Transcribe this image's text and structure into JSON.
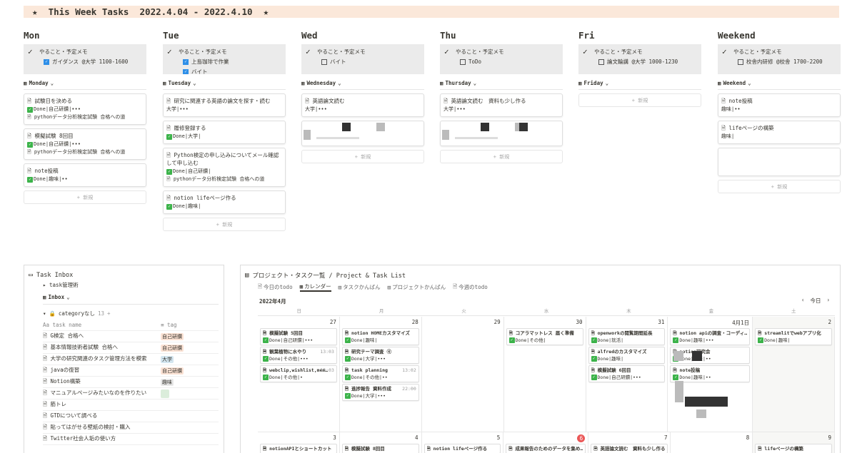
{
  "banner": "★  This Week Tasks  2022.4.04 - 2022.4.10  ★",
  "columns": [
    {
      "day": "Mon",
      "memo": "やること・予定メモ",
      "subs": [
        {
          "checked": true,
          "text": "ガイダンス @大学 1100-1600"
        }
      ],
      "group": "Monday",
      "cards": [
        {
          "name": "試験日を決める",
          "status": "Done|自己研鑽|•••",
          "rel": "pythonデータ分析検定試験 合格への道"
        },
        {
          "name": "模擬試験 8回目",
          "status": "Done|自己研鑽|•••",
          "rel": "pythonデータ分析検定試験 合格への道"
        },
        {
          "name": "note投稿",
          "status": "Done|趣味|••",
          "rel": ""
        }
      ]
    },
    {
      "day": "Tue",
      "memo": "やること・予定メモ",
      "subs": [
        {
          "checked": true,
          "text": "上島珈琲で作業"
        },
        {
          "checked": true,
          "text": "バイト"
        }
      ],
      "group": "Tuesday",
      "cards": [
        {
          "name": "研究に関連する英語の論文を探す・読む",
          "status": "大学|•••",
          "done": false,
          "rel": ""
        },
        {
          "name": "履修登録する",
          "status": "Done|大学|",
          "rel": ""
        },
        {
          "name": "Python検定の申し込みについてメール確認して申し込む",
          "status": "Done|自己研鑽|",
          "rel": "pythonデータ分析検定試験 合格への道"
        },
        {
          "name": "notion lifeページ作る",
          "status": "Done|趣味|",
          "rel": ""
        }
      ]
    },
    {
      "day": "Wed",
      "memo": "やること・予定メモ",
      "subs": [
        {
          "checked": false,
          "text": "バイト"
        }
      ],
      "group": "Wednesday",
      "cards": [
        {
          "name": "英語論文読む",
          "status": "大学|•••",
          "done": false,
          "rel": ""
        }
      ]
    },
    {
      "day": "Thu",
      "memo": "やること・予定メモ",
      "subs": [
        {
          "checked": false,
          "text": "ToDo"
        }
      ],
      "group": "Thursday",
      "cards": [
        {
          "name": "英語論文読む　資料も少し作る",
          "status": "大学|•••",
          "done": false,
          "rel": ""
        }
      ]
    },
    {
      "day": "Fri",
      "memo": "やること・予定メモ",
      "subs": [
        {
          "checked": false,
          "text": "論文輪講 @大学 1000-1230"
        }
      ],
      "group": "Friday",
      "cards": []
    },
    {
      "day": "Weekend",
      "memo": "やること・予定メモ",
      "subs": [
        {
          "checked": false,
          "text": "校舎内研修 @校舎 1700-2200"
        }
      ],
      "group": "Weekend",
      "cards": [
        {
          "name": "note投稿",
          "status": "趣味|••",
          "done": false,
          "rel": ""
        },
        {
          "name": "lifeページの構築",
          "status": "趣味|",
          "done": false,
          "rel": ""
        }
      ]
    }
  ],
  "new_label": "+ 新規",
  "inbox": {
    "title": "Task Inbox",
    "toggle": "task管理術",
    "view": "Inbox",
    "category": "categoryなし",
    "count": "13",
    "col_name": "task name",
    "col_tag": "tag",
    "rows": [
      {
        "name": "G検定 合格へ",
        "tag": "自己研鑽",
        "color": "#fbe2d4"
      },
      {
        "name": "基本情報技術者試験 合格へ",
        "tag": "自己研鑽",
        "color": "#fbe2d4"
      },
      {
        "name": "大学の研究関連のタスク管理方法を模索",
        "tag": "大学",
        "color": "#d3e5ef"
      },
      {
        "name": "javaの復習",
        "tag": "自己研鑽",
        "color": "#fbe2d4"
      },
      {
        "name": "Notion構築",
        "tag": "趣味",
        "color": "#e8e8e8"
      },
      {
        "name": "マニュアルページみたいなのを作りたい",
        "tag": "",
        "color": "#dbeddb"
      },
      {
        "name": "筋トレ",
        "tag": "",
        "color": ""
      },
      {
        "name": "GTDについて調べる",
        "tag": "",
        "color": ""
      },
      {
        "name": "貼ってはがせる壁紙の検討・購入",
        "tag": "",
        "color": ""
      },
      {
        "name": "Twitter社会人垢の使い方",
        "tag": "",
        "color": ""
      }
    ]
  },
  "project": {
    "title": "プロジェクト・タスク一覧 / Project & Task List",
    "tabs": [
      "今日のtodo",
      "カレンダー",
      "タスクかんばん",
      "プロジェクトかんばん",
      "今週のtodo"
    ],
    "month": "2022年4月",
    "today_label": "今日",
    "weekdays": [
      "日",
      "月",
      "火",
      "水",
      "木",
      "金",
      "土"
    ],
    "week1": {
      "dates": [
        "27",
        "28",
        "29",
        "30",
        "31",
        "4月1日",
        "2"
      ],
      "events": [
        [
          {
            "t": "模擬試験 5回目",
            "s": "Done|自己研鑽|•••",
            "tm": ""
          },
          {
            "t": "観葉植物に水やり",
            "s": "Done|その他|•••",
            "tm": "13:03"
          },
          {
            "t": "webclip,wishlist,mem…",
            "s": "Done|その他|•",
            "tm": "13:03"
          }
        ],
        [
          {
            "t": "notion HOMEカスタマイズ",
            "s": "Done|趣味|",
            "tm": ""
          },
          {
            "t": "研究テーマ調査 ④",
            "s": "Done|大学|•••",
            "tm": ""
          },
          {
            "t": "task planning",
            "s": "Done|その他|••",
            "tm": "13:02"
          },
          {
            "t": "進捗報告 資料作成",
            "s": "Done|大学|•••",
            "tm": "22:00"
          }
        ],
        [],
        [
          {
            "t": "コアラマットレス 届く準備",
            "s": "Done|その他|",
            "tm": ""
          }
        ],
        [
          {
            "t": "openworkの閲覧期間延長",
            "s": "Done|就活|",
            "tm": ""
          },
          {
            "t": "alfredのカスタマイズ",
            "s": "Done|趣味|",
            "tm": ""
          },
          {
            "t": "模擬試験 6回目",
            "s": "Done|自己研鑽|•••",
            "tm": ""
          }
        ],
        [
          {
            "t": "notion apiの調査・コーディ…",
            "s": "Done|趣味|•••",
            "tm": ""
          },
          {
            "t": "notion研究会",
            "s": "Done|趣味|••",
            "tm": ""
          },
          {
            "t": "note投稿",
            "s": "Done|趣味|••",
            "tm": ""
          }
        ],
        [
          {
            "t": "streamlitでwebアプリ化",
            "s": "Done|趣味|",
            "tm": ""
          }
        ]
      ]
    },
    "week2": {
      "dates": [
        "3",
        "4",
        "5",
        "6",
        "7",
        "8",
        "9"
      ],
      "events": [
        [
          {
            "t": "notionAPIとショートカット",
            "s": ""
          }
        ],
        [
          {
            "t": "模擬試験 8回目",
            "s": ""
          }
        ],
        [
          {
            "t": "notion lifeページ作る",
            "s": ""
          }
        ],
        [
          {
            "t": "成果報告のためのデータを集め…",
            "s": ""
          }
        ],
        [
          {
            "t": "英語論文読む　資料も少し作る",
            "s": ""
          }
        ],
        [],
        [
          {
            "t": "lifeページの構築",
            "s": ""
          }
        ]
      ]
    }
  }
}
